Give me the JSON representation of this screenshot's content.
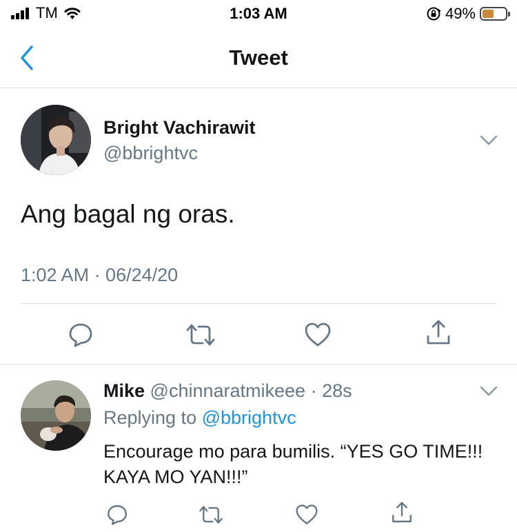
{
  "status_bar": {
    "carrier": "TM",
    "time": "1:03 AM",
    "battery_percent": "49%",
    "battery_level": 0.49,
    "icons": [
      "signal-icon",
      "wifi-icon",
      "orientation-lock-icon",
      "battery-icon"
    ]
  },
  "nav": {
    "back_icon": "chevron-left-icon",
    "title": "Tweet"
  },
  "tweet": {
    "author_name": "Bright Vachirawit",
    "author_handle": "@bbrightvc",
    "text": "Ang bagal ng oras.",
    "timestamp": "1:02 AM · 06/24/20",
    "actions": [
      "reply-icon",
      "retweet-icon",
      "like-icon",
      "share-icon"
    ]
  },
  "reply": {
    "author_name": "Mike",
    "author_handle": "@chinnaratmikeee",
    "separator": "·",
    "time_ago": "28s",
    "replying_prefix": "Replying to",
    "replying_to": "@bbrightvc",
    "text": "Encourage mo para bumilis. “YES GO TIME!!! KAYA MO YAN!!!”",
    "actions": [
      "reply-icon",
      "retweet-icon",
      "like-icon",
      "share-icon"
    ]
  },
  "colors": {
    "accent": "#1b95e0",
    "secondary_text": "#657786",
    "divider": "#d6dade",
    "battery": "#c88a3a"
  }
}
